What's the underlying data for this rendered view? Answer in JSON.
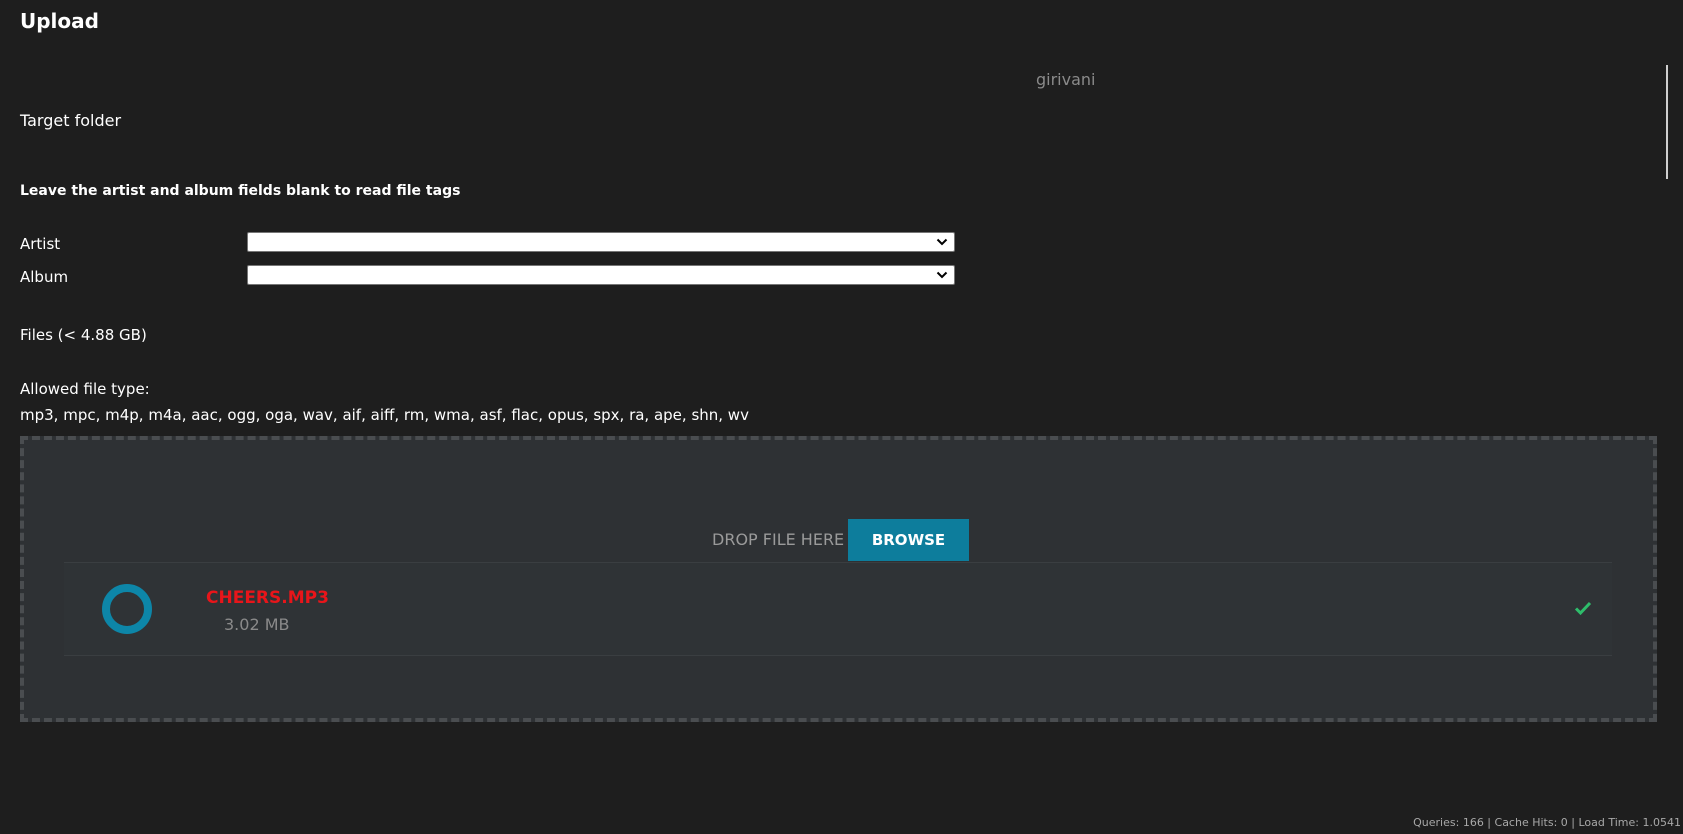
{
  "title": "Upload",
  "target_folder": {
    "label": "Target folder",
    "value": "girivani"
  },
  "hint": "Leave the artist and album fields blank to read file tags",
  "artist": {
    "label": "Artist",
    "value": "",
    "icon": "chevron-down-icon"
  },
  "album": {
    "label": "Album",
    "value": "",
    "icon": "chevron-down-icon"
  },
  "files": {
    "label": "Files (< 4.88 GB)",
    "allowed_label": "Allowed file type:",
    "allowed_types": "mp3, mpc, m4p, m4a, aac, ogg, oga, wav, aif, aiff, rm, wma, asf, flac, opus, spx, ra, ape, shn, wv"
  },
  "dropzone": {
    "drop_text": "DROP FILE HERE",
    "browse_label": "BROWSE"
  },
  "uploaded_file": {
    "name": "CHEERS.MP3",
    "size": "3.02 MB",
    "status_icon": "check-icon",
    "progress_icon": "progress-ring-icon"
  },
  "footer": "Queries: 166 | Cache Hits: 0 | Load Time: 1.0541",
  "colors": {
    "background": "#1e1e1e",
    "dropzone": "#2e3134",
    "accent": "#0d7d9c",
    "file_name": "#e8151a",
    "success": "#2ebd6b"
  }
}
